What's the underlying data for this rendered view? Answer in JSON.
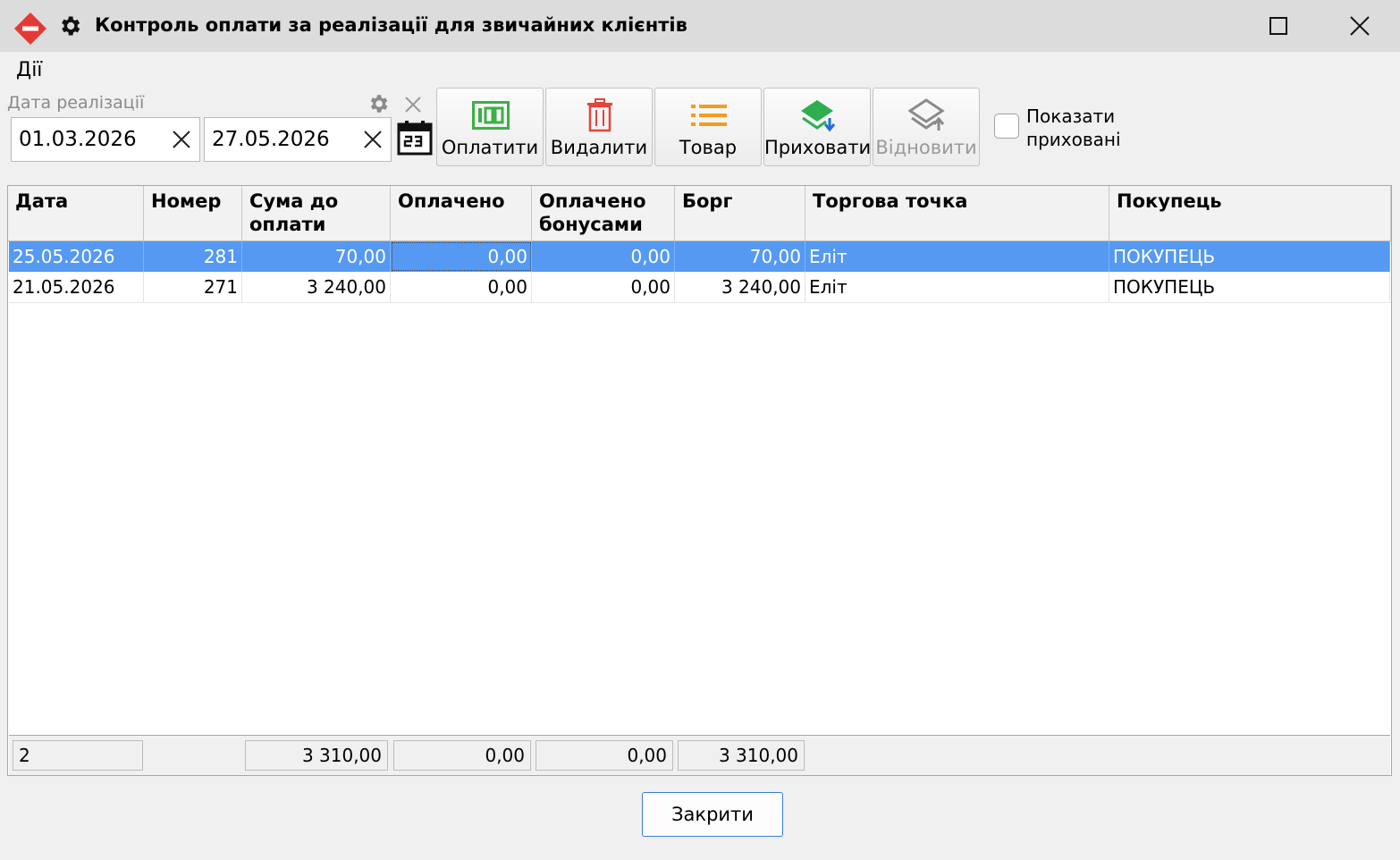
{
  "window": {
    "title": "Контроль оплати за реалізації для звичайних клієнтів"
  },
  "menu": {
    "actions": "Дії"
  },
  "filter": {
    "label": "Дата реалізації",
    "date_from": "01.03.2026",
    "date_to": "27.05.2026"
  },
  "toolbar": {
    "pay": "Оплатити",
    "delete": "Видалити",
    "goods": "Товар",
    "hide": "Приховати",
    "restore": "Відновити",
    "show_hidden": "Показати\nприховані"
  },
  "colors": {
    "selection": "#5599f2",
    "pay_icon": "#3cb043",
    "delete_icon": "#e0463a",
    "goods_icon": "#f39c1f",
    "hide_icon": "#2eae4e",
    "app_icon": "#e53935"
  },
  "table": {
    "columns": [
      "Дата",
      "Номер",
      "Сума до оплати",
      "Оплачено",
      "Оплачено бонусами",
      "Борг",
      "Торгова точка",
      "Покупець"
    ],
    "rows": [
      [
        "25.05.2026",
        "281",
        "70,00",
        "0,00",
        "0,00",
        "70,00",
        "Еліт",
        "ПОКУПЕЦЬ"
      ],
      [
        "21.05.2026",
        "271",
        "3 240,00",
        "0,00",
        "0,00",
        "3 240,00",
        "Еліт",
        "ПОКУПЕЦЬ"
      ]
    ],
    "selected_row": 0,
    "footer": {
      "count": "2",
      "sum_to_pay": "3 310,00",
      "paid": "0,00",
      "paid_bonus": "0,00",
      "debt": "3 310,00"
    }
  },
  "buttons": {
    "close": "Закрити"
  }
}
